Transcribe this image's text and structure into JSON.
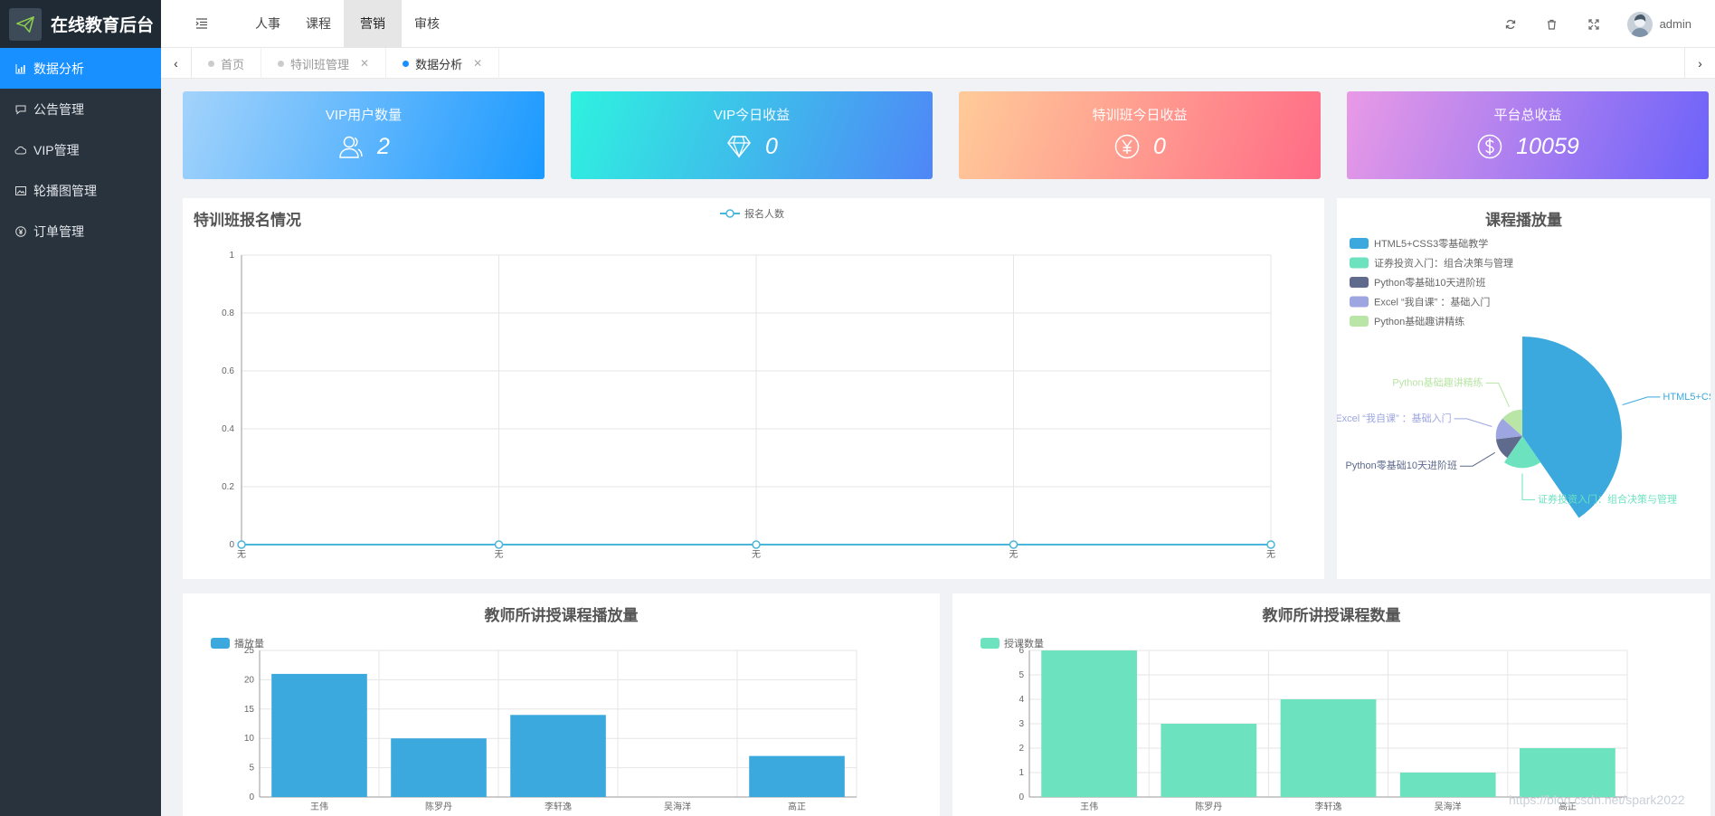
{
  "app": {
    "title": "在线教育后台",
    "logo_icon": "paper-plane-icon"
  },
  "sidebar": {
    "items": [
      {
        "label": "数据分析",
        "icon": "bar-chart-icon",
        "active": true
      },
      {
        "label": "公告管理",
        "icon": "chat-icon",
        "active": false
      },
      {
        "label": "VIP管理",
        "icon": "cloud-icon",
        "active": false
      },
      {
        "label": "轮播图管理",
        "icon": "image-icon",
        "active": false
      },
      {
        "label": "订单管理",
        "icon": "yen-circle-icon",
        "active": false
      }
    ]
  },
  "header": {
    "nav": [
      "人事",
      "课程",
      "营销",
      "审核"
    ],
    "active_nav": "营销",
    "user": "admin",
    "icons": [
      "refresh-icon",
      "trash-icon",
      "fullscreen-icon"
    ]
  },
  "tabs": [
    {
      "label": "首页",
      "closable": false,
      "active": false
    },
    {
      "label": "特训班管理",
      "closable": true,
      "active": false
    },
    {
      "label": "数据分析",
      "closable": true,
      "active": true
    }
  ],
  "stats": [
    {
      "title": "VIP用户数量",
      "value": "2",
      "icon": "users-icon"
    },
    {
      "title": "VIP今日收益",
      "value": "0",
      "icon": "diamond-icon"
    },
    {
      "title": "特训班今日收益",
      "value": "0",
      "icon": "yen-icon"
    },
    {
      "title": "平台总收益",
      "value": "10059",
      "icon": "dollar-icon"
    }
  ],
  "panels": {
    "signup_title": "特训班报名情况",
    "play_title": "课程播放量",
    "teacher_play_title": "教师所讲授课程播放量",
    "teacher_count_title": "教师所讲授课程数量"
  },
  "watermark": "https://blog.csdn.net/spark2022",
  "chart_data": [
    {
      "type": "line",
      "title": "特训班报名情况",
      "series": [
        {
          "name": "报名人数",
          "values": [
            0,
            0,
            0,
            0,
            0
          ]
        }
      ],
      "categories": [
        "无",
        "无",
        "无",
        "无",
        "无"
      ],
      "ylim": [
        0,
        1
      ],
      "yticks": [
        "0",
        "0.2",
        "0.4",
        "0.6",
        "0.8",
        "1"
      ],
      "color": "#4bb6db",
      "grid": true,
      "legend": "top-center"
    },
    {
      "type": "pie",
      "title": "课程播放量",
      "rose": true,
      "slices": [
        {
          "name": "HTML5+CSS3零基础教学",
          "label": "HTML5+CSS3零基础教学",
          "value": 21,
          "color": "#3ba9de"
        },
        {
          "name": "证券投资入门：组合决策与管理",
          "label": "证券投资入门：组合决策与管理",
          "value": 10,
          "color": "#6de2bf"
        },
        {
          "name": "Python零基础10天进阶班",
          "label": "Python零基础10天进阶班",
          "value": 7,
          "color": "#5f6a8c"
        },
        {
          "name": "Excel “我自课” ：基础入门",
          "label": "Excel “我自课” ：基础入门",
          "value": 7,
          "color": "#9da6e0"
        },
        {
          "name": "Python基础趣讲精练",
          "label": "Python基础趣讲精练",
          "value": 7,
          "color": "#b9e5a6"
        }
      ],
      "legend": "top-left"
    },
    {
      "type": "bar",
      "title": "教师所讲授课程播放量",
      "categories": [
        "王伟",
        "陈罗丹",
        "李轩逸",
        "吴海洋",
        "高正"
      ],
      "series": [
        {
          "name": "播放量",
          "values": [
            21,
            10,
            14,
            0,
            7
          ]
        }
      ],
      "ylim": [
        0,
        25
      ],
      "yticks": [
        "0",
        "5",
        "10",
        "15",
        "20",
        "25"
      ],
      "color": "#3ba9de",
      "grid": true,
      "legend": "top-left"
    },
    {
      "type": "bar",
      "title": "教师所讲授课程数量",
      "categories": [
        "王伟",
        "陈罗丹",
        "李轩逸",
        "吴海洋",
        "高正"
      ],
      "series": [
        {
          "name": "授课数量",
          "values": [
            6,
            3,
            4,
            1,
            2
          ]
        }
      ],
      "ylim": [
        0,
        6
      ],
      "yticks": [
        "0",
        "1",
        "2",
        "3",
        "4",
        "5",
        "6"
      ],
      "color": "#6de2bf",
      "grid": true,
      "legend": "top-left"
    }
  ]
}
